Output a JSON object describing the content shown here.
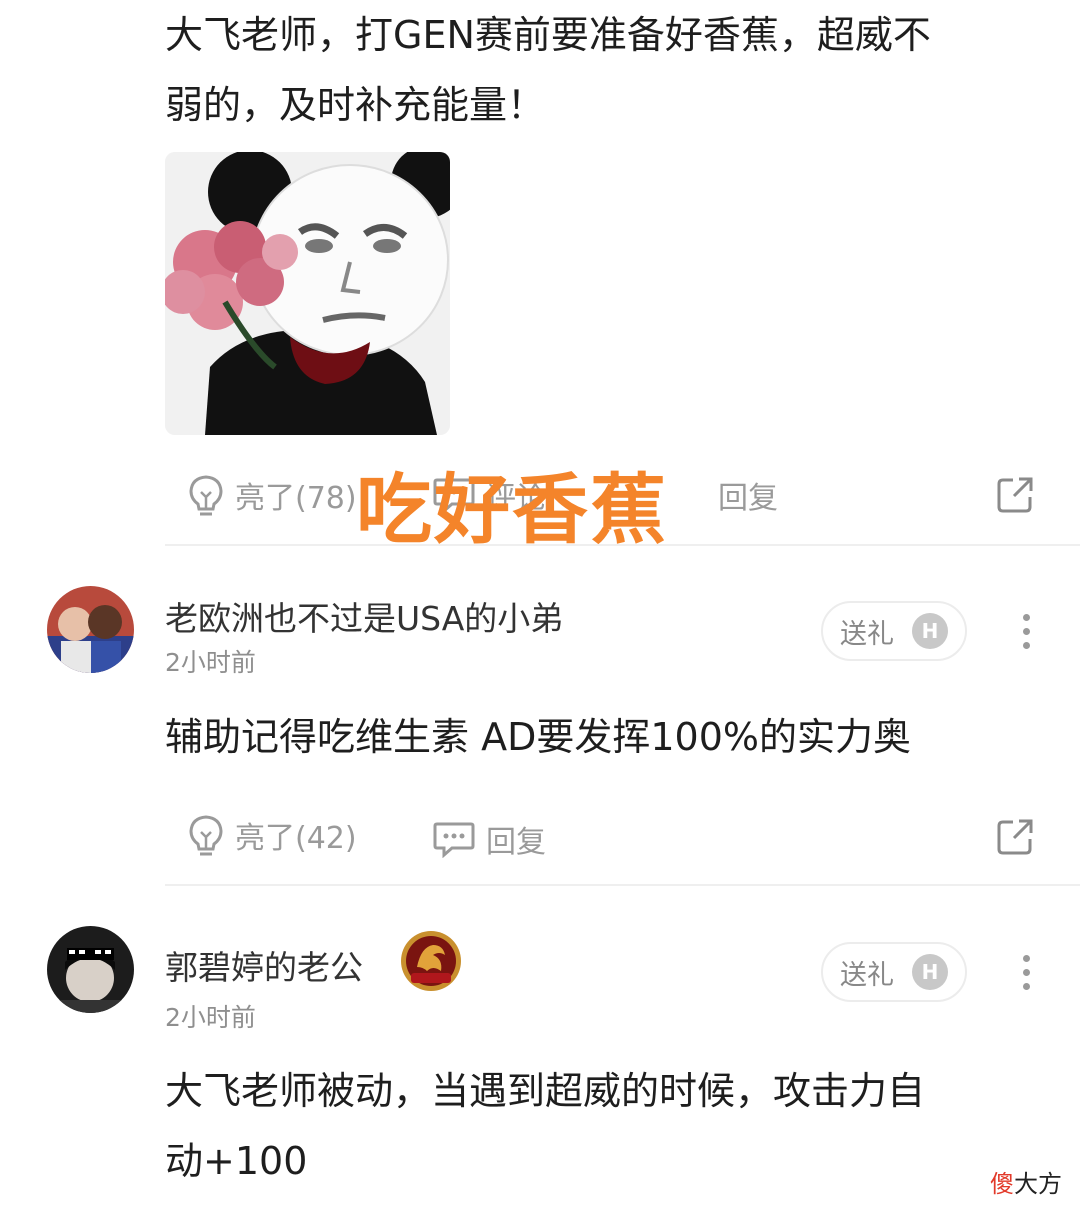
{
  "post": {
    "text_line1": "大飞老师，打GEN赛前要准备好香蕉，超威不",
    "text_line2": "弱的，及时补充能量！",
    "like_label": "亮了(78)",
    "comment_label": "评论",
    "reply_label": "回复"
  },
  "overlay": {
    "caption": "吃好香蕉"
  },
  "comments": [
    {
      "username": "老欧洲也不过是USA的小弟",
      "time": "2小时前",
      "gift_label": "送礼",
      "gift_badge": "H",
      "text": "辅助记得吃维生素 AD要发挥100%的实力奥",
      "like_label": "亮了(42)",
      "reply_label": "回复"
    },
    {
      "username": "郭碧婷的老公",
      "time": "2小时前",
      "gift_label": "送礼",
      "gift_badge": "H",
      "text_line1": "大飞老师被动，当遇到超威的时候，攻击力自",
      "text_line2": "动+100"
    }
  ],
  "watermark": {
    "first_char": "傻",
    "rest": "大方"
  },
  "colors": {
    "overlay_orange": "#f4842a",
    "watermark_red": "#e23a2a"
  }
}
